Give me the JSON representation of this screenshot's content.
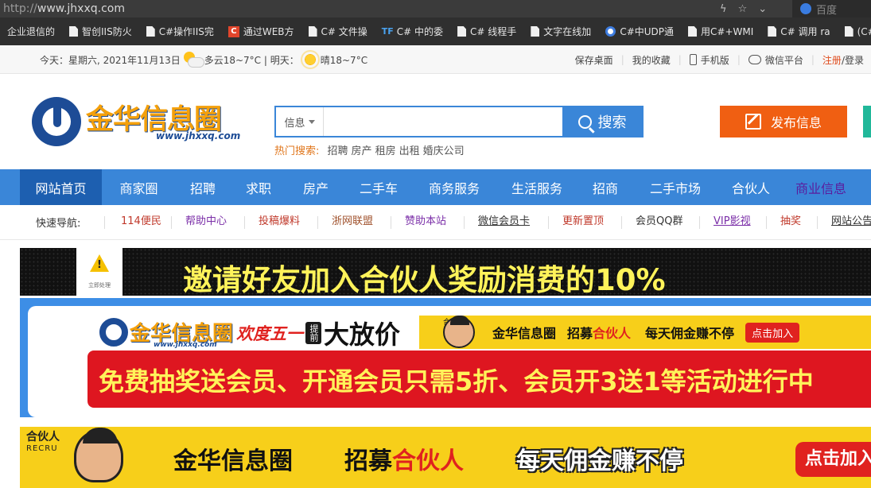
{
  "browser": {
    "url_proto": "http://",
    "url_host": "www.jhxxq.com",
    "search_engine": "百度",
    "bookmarks": [
      {
        "label": "企业退信的",
        "icon": "none"
      },
      {
        "label": "智创IIS防火",
        "icon": "page-icon"
      },
      {
        "label": "C#操作IIS完",
        "icon": "page-icon"
      },
      {
        "label": "通过WEB方",
        "icon": "c-red-icon"
      },
      {
        "label": "C# 文件操",
        "icon": "page-icon"
      },
      {
        "label": "C# 中的委",
        "icon": "tf-icon"
      },
      {
        "label": "C# 线程手",
        "icon": "page-icon"
      },
      {
        "label": "文字在线加",
        "icon": "page-icon"
      },
      {
        "label": "C#中UDP通",
        "icon": "circle-icon"
      },
      {
        "label": "用C#+WMI",
        "icon": "page-icon"
      },
      {
        "label": "C# 调用 ra",
        "icon": "page-icon"
      },
      {
        "label": "(C# 查询",
        "icon": "page-icon"
      }
    ]
  },
  "topbar": {
    "date_text": "今天：星期六, 2021年11月13日",
    "today_weather": "多云18~7°C | 明天：",
    "tomorrow_weather": "晴18~7°C",
    "links": {
      "desktop": "保存桌面",
      "favorite": "我的收藏",
      "mobile": "手机版",
      "wechat": "微信平台",
      "register": "注册",
      "slash": "/",
      "login": "登录"
    }
  },
  "header": {
    "logo_cn": "金华信息圈",
    "logo_domain": "www.jhxxq.com",
    "search_category": "信息",
    "search_value": "",
    "search_button": "搜索",
    "hot_label": "热门搜索:",
    "hot_keywords": [
      "招聘",
      "房产",
      "租房",
      "出租",
      "婚庆公司"
    ],
    "publish_button": "发布信息"
  },
  "mainnav": [
    {
      "label": "网站首页",
      "w": 103
    },
    {
      "label": "商家圈",
      "w": 93
    },
    {
      "label": "招聘",
      "w": 68
    },
    {
      "label": "求职",
      "w": 72
    },
    {
      "label": "房产",
      "w": 72
    },
    {
      "label": "二手车",
      "w": 86
    },
    {
      "label": "商务服务",
      "w": 104
    },
    {
      "label": "生活服务",
      "w": 104
    },
    {
      "label": "招商",
      "w": 68
    },
    {
      "label": "二手市场",
      "w": 108
    },
    {
      "label": "合伙人",
      "w": 82
    },
    {
      "label": "商业信息",
      "w": 94
    }
  ],
  "quicknav": {
    "label": "快速导航:",
    "items": [
      {
        "label": "114便民",
        "color": "#c0392b"
      },
      {
        "label": "帮助中心",
        "color": "#7b2fa8"
      },
      {
        "label": "投稿爆料",
        "color": "#c0392b"
      },
      {
        "label": "浙网联盟",
        "color": "#a0522d"
      },
      {
        "label": "赞助本站",
        "color": "#7b2fa8"
      },
      {
        "label": "微信会员卡",
        "color": "#333333"
      },
      {
        "label": "更新置顶",
        "color": "#c0392b"
      },
      {
        "label": "会员QQ群",
        "color": "#333333"
      },
      {
        "label": "VIP影视",
        "color": "#7b2fa8"
      },
      {
        "label": "抽奖",
        "color": "#c0392b"
      },
      {
        "label": "网站公告",
        "color": "#333333"
      }
    ]
  },
  "banners": {
    "b1_warn_text": "立即处理",
    "b1_text": "邀请好友加入合伙人奖励消费的10%",
    "b2_logo_cn": "金华信息圈",
    "b2_logo_domain": "www.jhxxq.com",
    "b2_holiday_1": "欢度五一",
    "b2_holiday_2": "提前",
    "b2_holiday_3": "大放价",
    "b2_tag": "合伙人",
    "b2_s1": "金华信息圈",
    "b2_s2a": "招募",
    "b2_s2b": "合伙人",
    "b2_s3": "每天佣金赚不停",
    "b2_s4": "点击加入",
    "b2_red_text": "免费抽奖送会员、开通会员只需5折、会员开3送1等活动进行中",
    "b3_tag": "合伙人",
    "b3_tag2": "RECRU",
    "b3_t1": "金华信息圈",
    "b3_t2a": "招募",
    "b3_t2b": "合伙人",
    "b3_t3": "每天佣金赚不停",
    "b3_t4": "点击加入"
  }
}
